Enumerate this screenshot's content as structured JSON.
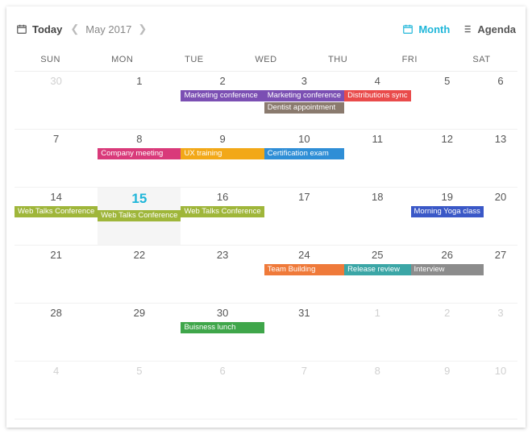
{
  "header": {
    "today_label": "Today",
    "period_label": "May 2017",
    "view_month_label": "Month",
    "view_agenda_label": "Agenda"
  },
  "day_headers": [
    "SUN",
    "MON",
    "TUE",
    "WED",
    "THU",
    "FRI",
    "SAT"
  ],
  "weeks": [
    [
      {
        "n": "30",
        "other": true
      },
      {
        "n": "1"
      },
      {
        "n": "2",
        "events": [
          {
            "label": "Marketing conference",
            "color": "#7b4fb3"
          }
        ]
      },
      {
        "n": "3",
        "events": [
          {
            "label": "Marketing conference",
            "color": "#7b4fb3"
          },
          {
            "label": "Dentist appointment",
            "color": "#8a7a6e"
          }
        ]
      },
      {
        "n": "4",
        "events": [
          {
            "label": "Distributions sync",
            "color": "#e94b4b"
          }
        ]
      },
      {
        "n": "5"
      },
      {
        "n": "6"
      }
    ],
    [
      {
        "n": "7"
      },
      {
        "n": "8",
        "events": [
          {
            "label": "Company meeting",
            "color": "#d93a7a"
          }
        ]
      },
      {
        "n": "9",
        "events": [
          {
            "label": "UX training",
            "color": "#f2a818"
          }
        ]
      },
      {
        "n": "10",
        "events": [
          {
            "label": "Certification exam",
            "color": "#2f8ed6"
          }
        ]
      },
      {
        "n": "11"
      },
      {
        "n": "12"
      },
      {
        "n": "13"
      }
    ],
    [
      {
        "n": "14",
        "events": [
          {
            "label": "Web Talks Conference",
            "color": "#9fb63a"
          }
        ]
      },
      {
        "n": "15",
        "today": true,
        "events": [
          {
            "label": "Web Talks Conference",
            "color": "#9fb63a"
          }
        ]
      },
      {
        "n": "16",
        "events": [
          {
            "label": "Web Talks Conference",
            "color": "#9fb63a"
          }
        ]
      },
      {
        "n": "17"
      },
      {
        "n": "18"
      },
      {
        "n": "19",
        "events": [
          {
            "label": "Morning Yoga class",
            "color": "#3a58c7"
          }
        ]
      },
      {
        "n": "20"
      }
    ],
    [
      {
        "n": "21"
      },
      {
        "n": "22"
      },
      {
        "n": "23"
      },
      {
        "n": "24",
        "events": [
          {
            "label": "Team Building",
            "color": "#ef7a3a"
          }
        ]
      },
      {
        "n": "25",
        "events": [
          {
            "label": "Release review",
            "color": "#3ba6a6"
          }
        ]
      },
      {
        "n": "26",
        "events": [
          {
            "label": "Interview",
            "color": "#8c8c8c"
          }
        ]
      },
      {
        "n": "27"
      }
    ],
    [
      {
        "n": "28"
      },
      {
        "n": "29"
      },
      {
        "n": "30",
        "events": [
          {
            "label": "Buisness lunch",
            "color": "#3fa64a"
          }
        ]
      },
      {
        "n": "31"
      },
      {
        "n": "1",
        "other": true
      },
      {
        "n": "2",
        "other": true
      },
      {
        "n": "3",
        "other": true
      }
    ],
    [
      {
        "n": "4",
        "other": true
      },
      {
        "n": "5",
        "other": true
      },
      {
        "n": "6",
        "other": true
      },
      {
        "n": "7",
        "other": true
      },
      {
        "n": "8",
        "other": true
      },
      {
        "n": "9",
        "other": true
      },
      {
        "n": "10",
        "other": true
      }
    ]
  ]
}
